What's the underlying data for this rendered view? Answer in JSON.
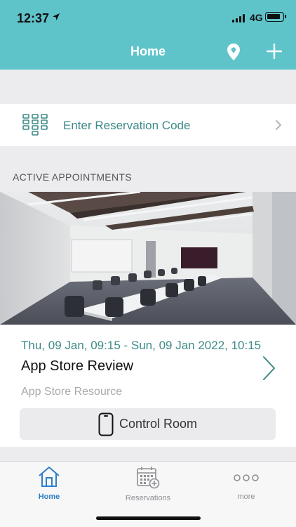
{
  "status_bar": {
    "time": "12:37",
    "network": "4G"
  },
  "nav": {
    "title": "Home"
  },
  "reservation_code": {
    "label": "Enter Reservation Code"
  },
  "section": {
    "title": "ACTIVE APPOINTMENTS"
  },
  "appointment": {
    "time_range": "Thu, 09 Jan, 09:15 - Sun, 09 Jan 2022, 10:15",
    "title": "App Store Review",
    "resource": "App Store Resource",
    "control_button": "Control Room"
  },
  "tabs": [
    {
      "label": "Home",
      "icon": "house-icon",
      "active": true
    },
    {
      "label": "Reservations",
      "icon": "calendar-add-icon",
      "active": false
    },
    {
      "label": "more",
      "icon": "ellipsis-icon",
      "active": false
    }
  ],
  "colors": {
    "header": "#5fc4ca",
    "accent_text": "#3d8a87",
    "active_tab": "#2f7fc8"
  }
}
